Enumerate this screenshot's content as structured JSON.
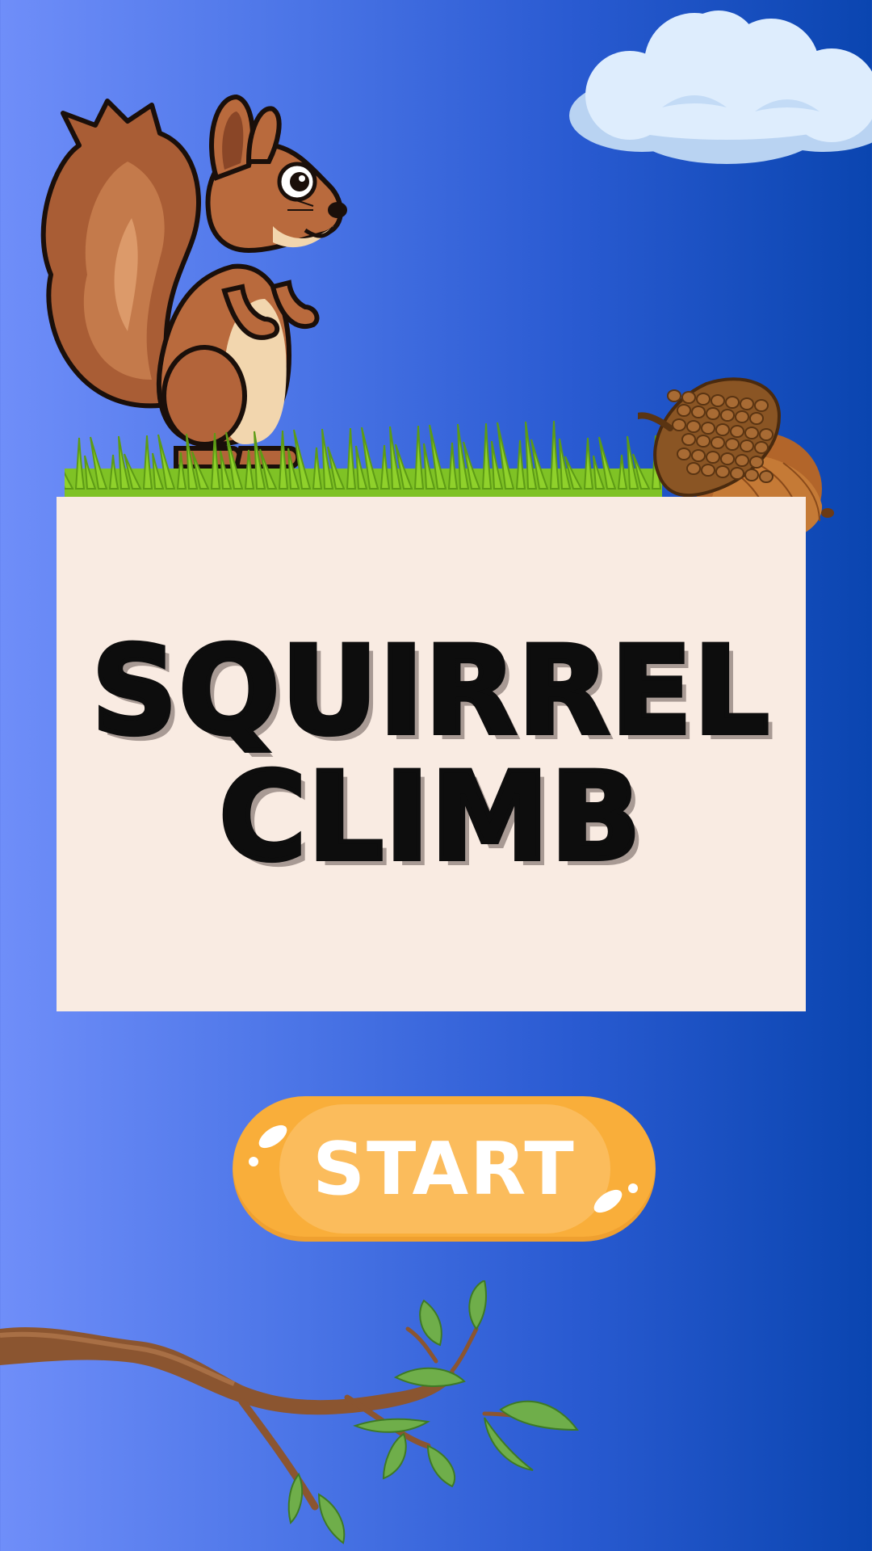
{
  "screen": "title",
  "title": {
    "line1": "SQUIRREL",
    "line2": "CLIMB"
  },
  "start_button": {
    "label": "START"
  },
  "decorations": {
    "icons": [
      "cloud-icon",
      "squirrel-icon",
      "grass-icon",
      "acorn-icon",
      "branch-icon"
    ]
  },
  "colors": {
    "background_left": "#6f8ef9",
    "background_right": "#0a45b0",
    "panel": "#f9ebe2",
    "title_text": "#0d0d0d",
    "button": "#f9ae3a",
    "button_text": "#ffffff"
  }
}
